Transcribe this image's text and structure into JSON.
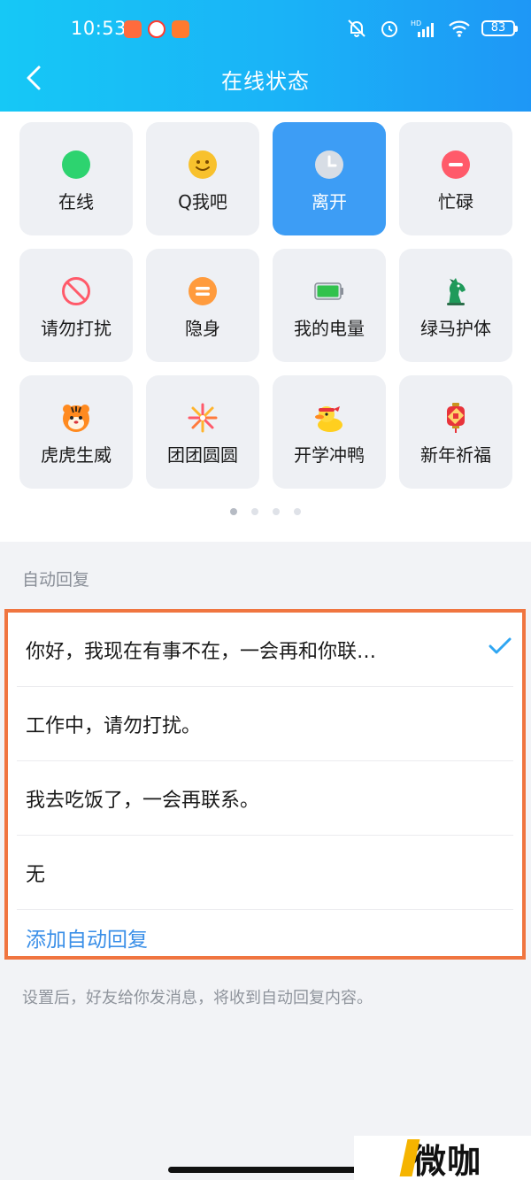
{
  "status_bar": {
    "time": "10:53",
    "battery": "83",
    "network": "HD"
  },
  "header": {
    "title": "在线状态"
  },
  "status_grid": [
    {
      "label": "在线",
      "icon": "green-dot-icon"
    },
    {
      "label": "Q我吧",
      "icon": "smiley-icon"
    },
    {
      "label": "离开",
      "icon": "clock-icon",
      "selected": true
    },
    {
      "label": "忙碌",
      "icon": "minus-circle-icon"
    },
    {
      "label": "请勿打扰",
      "icon": "no-entry-icon"
    },
    {
      "label": "隐身",
      "icon": "equals-circle-icon"
    },
    {
      "label": "我的电量",
      "icon": "battery-icon"
    },
    {
      "label": "绿马护体",
      "icon": "green-horse-icon"
    },
    {
      "label": "虎虎生威",
      "icon": "tiger-icon"
    },
    {
      "label": "团团圆圆",
      "icon": "firework-icon"
    },
    {
      "label": "开学冲鸭",
      "icon": "duck-icon"
    },
    {
      "label": "新年祈福",
      "icon": "lantern-fu-icon"
    }
  ],
  "pager": {
    "count": 4,
    "active": 0
  },
  "auto_reply": {
    "section_label": "自动回复",
    "items": [
      {
        "text": "你好，我现在有事不在，一会再和你联…",
        "checked": true
      },
      {
        "text": "工作中，请勿打扰。"
      },
      {
        "text": "我去吃饭了，一会再联系。"
      },
      {
        "text": "无"
      }
    ],
    "add_label": "添加自动回复",
    "hint": "设置后，好友给你发消息，将收到自动回复内容。"
  },
  "watermark": {
    "text": "微咖"
  },
  "colors": {
    "header": "#1ab2f7",
    "selected_tile": "#3d9df5",
    "highlight_border": "#f07540",
    "link": "#3a8fe8"
  }
}
